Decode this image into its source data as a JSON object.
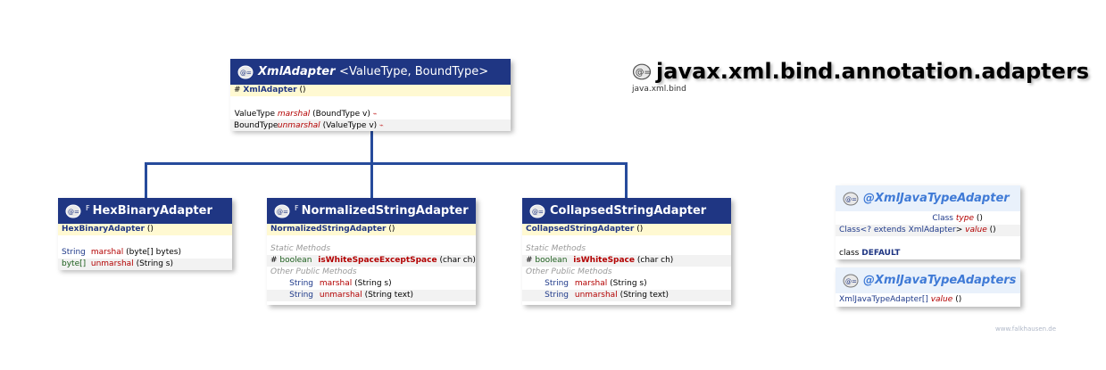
{
  "package": {
    "name": "javax.xml.bind.annotation.adapters",
    "module": "java.xml.bind"
  },
  "classes": {
    "xmladapter": {
      "name": "XmlAdapter",
      "type_params": "<ValueType, BoundType>",
      "ctor_mod": "#",
      "ctor_name": "XmlAdapter",
      "ctor_args": "()",
      "methods": [
        {
          "ret": "ValueType",
          "name": "marshal",
          "args": "(BoundType v)",
          "mark": "⌁"
        },
        {
          "ret": "BoundType",
          "name": "unmarshal",
          "args": "(ValueType v)",
          "mark": "⌁"
        }
      ]
    },
    "hexbinary": {
      "mod": "F",
      "name": "HexBinaryAdapter",
      "ctor_name": "HexBinaryAdapter",
      "ctor_args": "()",
      "methods": [
        {
          "ret": "String",
          "name": "marshal",
          "args": "(byte[] bytes)"
        },
        {
          "ret": "byte[]",
          "name": "unmarshal",
          "args": "(String s)"
        }
      ]
    },
    "normalized": {
      "mod": "F",
      "name": "NormalizedStringAdapter",
      "ctor_name": "NormalizedStringAdapter",
      "ctor_args": "()",
      "static_label": "Static Methods",
      "static_methods": [
        {
          "mod": "#",
          "ret": "boolean",
          "name": "isWhiteSpaceExceptSpace",
          "args": "(char ch)"
        }
      ],
      "public_label": "Other Public Methods",
      "methods": [
        {
          "ret": "String",
          "name": "marshal",
          "args": "(String s)"
        },
        {
          "ret": "String",
          "name": "unmarshal",
          "args": "(String text)"
        }
      ]
    },
    "collapsed": {
      "name": "CollapsedStringAdapter",
      "ctor_name": "CollapsedStringAdapter",
      "ctor_args": "()",
      "static_label": "Static Methods",
      "static_methods": [
        {
          "mod": "#",
          "ret": "boolean",
          "name": "isWhiteSpace",
          "args": "(char ch)"
        }
      ],
      "public_label": "Other Public Methods",
      "methods": [
        {
          "ret": "String",
          "name": "marshal",
          "args": "(String s)"
        },
        {
          "ret": "String",
          "name": "unmarshal",
          "args": "(String text)"
        }
      ]
    }
  },
  "annotations": {
    "xmljavatypeadapter": {
      "name": "@XmlJavaTypeAdapter",
      "rows": [
        {
          "ret": "Class",
          "name": "type",
          "args": "()"
        },
        {
          "ret_prefix": "Class<? extends ",
          "ret_type": "XmlAdapter",
          "ret_suffix": ">",
          "name": "value",
          "args": "()"
        }
      ],
      "field_kw": "class",
      "field_name": "DEFAULT"
    },
    "xmljavatypeadapters": {
      "name": "@XmlJavaTypeAdapters",
      "rows": [
        {
          "ret": "XmlJavaTypeAdapter[]",
          "name": "value",
          "args": "()"
        }
      ]
    }
  },
  "watermark": "www.falkhausen.de",
  "colors": {
    "header": "#1f3683",
    "connector": "#264b9c",
    "ctor_bg": "#fff9d2",
    "annotation_header": "#e9f1fb",
    "method": "#b30000"
  }
}
